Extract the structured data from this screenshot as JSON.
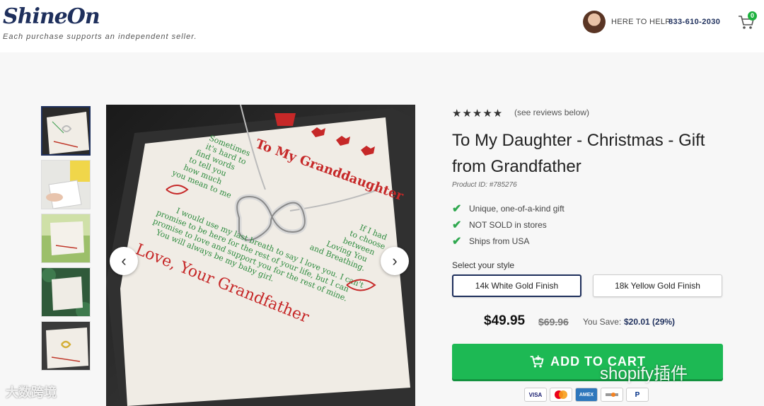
{
  "header": {
    "logo_text": "ShineOn",
    "tagline": "Each purchase supports an independent seller.",
    "help_label": "HERE TO HELP",
    "phone": "833-610-2030",
    "cart_count": "0"
  },
  "gallery": {
    "prev_icon": "‹",
    "next_icon": "›",
    "card_heading": "To My Granddaughter",
    "card_poem": "Sometimes it's hard to find words to tell you how much you mean to me",
    "card_body": "I would use my last breath to say I love you. I can't promise to be here for the rest of your life, but I can promise to love and support you for the rest of mine. You will always be my baby girl.",
    "card_side": "If I had to choose between Loving You and Breathing.",
    "card_signoff": "Love, Your Grandfather"
  },
  "product": {
    "stars": "★★★★★",
    "reviews_link": "(see reviews below)",
    "title": "To My Daughter - Christmas - Gift from Grandfather",
    "product_id": "Product ID: #785276",
    "features": [
      "Unique, one-of-a-kind gift",
      "NOT SOLD in stores",
      "Ships from USA"
    ],
    "style_label": "Select your style",
    "styles": [
      "14k White Gold Finish",
      "18k Yellow Gold Finish"
    ],
    "price": "$49.95",
    "old_price": "$69.96",
    "save_label": "You Save:",
    "save_amount": "$20.01 (29%)",
    "add_to_cart": "ADD TO CART",
    "payments": [
      "VISA",
      "Mastercard",
      "AMEX",
      "Discover",
      "PayPal"
    ]
  },
  "watermarks": {
    "left": "大数跨境",
    "right": "shopify插件"
  },
  "colors": {
    "brand_navy": "#1e2f5c",
    "cta_green": "#1db954",
    "check_green": "#2fa84f"
  }
}
